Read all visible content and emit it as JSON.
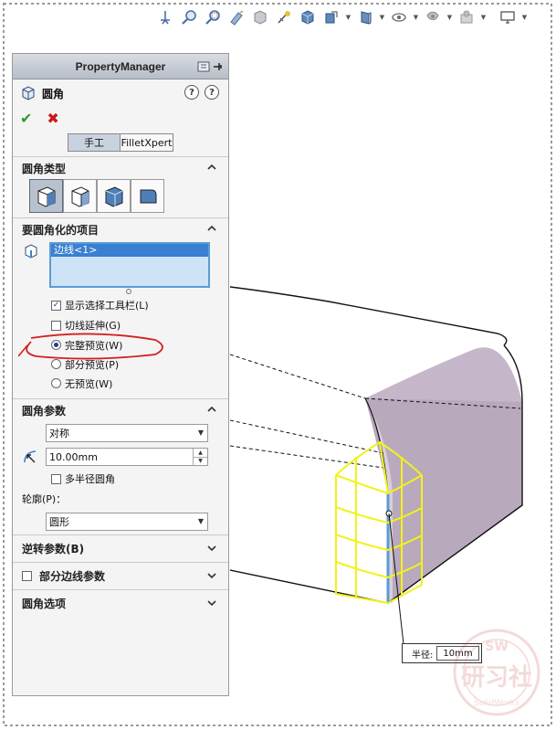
{
  "panel": {
    "header_title": "PropertyManager",
    "feature_title": "圆角",
    "ok_symbol": "✔",
    "cancel_symbol": "✖",
    "mode_tabs": [
      "手工",
      "FilletXpert"
    ]
  },
  "sections": {
    "fillet_type": {
      "title": "圆角类型"
    },
    "items": {
      "title": "要圆角化的项目",
      "selected": [
        "边线<1>"
      ],
      "show_toolbar": {
        "label": "显示选择工具栏(L)",
        "checked": true
      },
      "tangent": {
        "label": "切线延伸(G)",
        "checked": false
      },
      "preview_options": [
        {
          "label": "完整预览(W)",
          "selected": true
        },
        {
          "label": "部分预览(P)",
          "selected": false
        },
        {
          "label": "无预览(W)",
          "selected": false
        }
      ]
    },
    "params": {
      "title": "圆角参数",
      "method": "对称",
      "radius": "10.00mm",
      "multi_radius": {
        "label": "多半径圆角",
        "checked": false
      },
      "profile_label": "轮廓(P)：",
      "profile": "圆形"
    },
    "reverse": {
      "title": "逆转参数(B)"
    },
    "partial": {
      "title": "部分边线参数",
      "checked": false
    },
    "options": {
      "title": "圆角选项"
    }
  },
  "callout": {
    "label": "半径:",
    "value": "10mm"
  },
  "colors": {
    "accent_blue": "#3a7fd0",
    "preview_yellow": "#f2f21a",
    "annotation_red": "#d42020",
    "face_purple": "#b9a9bd"
  },
  "toolbar_icons": [
    "view-orientation-icon",
    "zoom-to-fit-icon",
    "zoom-area-icon",
    "previous-view-icon",
    "section-view-icon",
    "dynamic-annotation-icon",
    "view-orientation-cube-icon",
    "display-style-icon",
    "hide-show-icon",
    "edit-appearance-icon",
    "apply-scene-icon",
    "view-settings-icon",
    "monitor-icon"
  ]
}
